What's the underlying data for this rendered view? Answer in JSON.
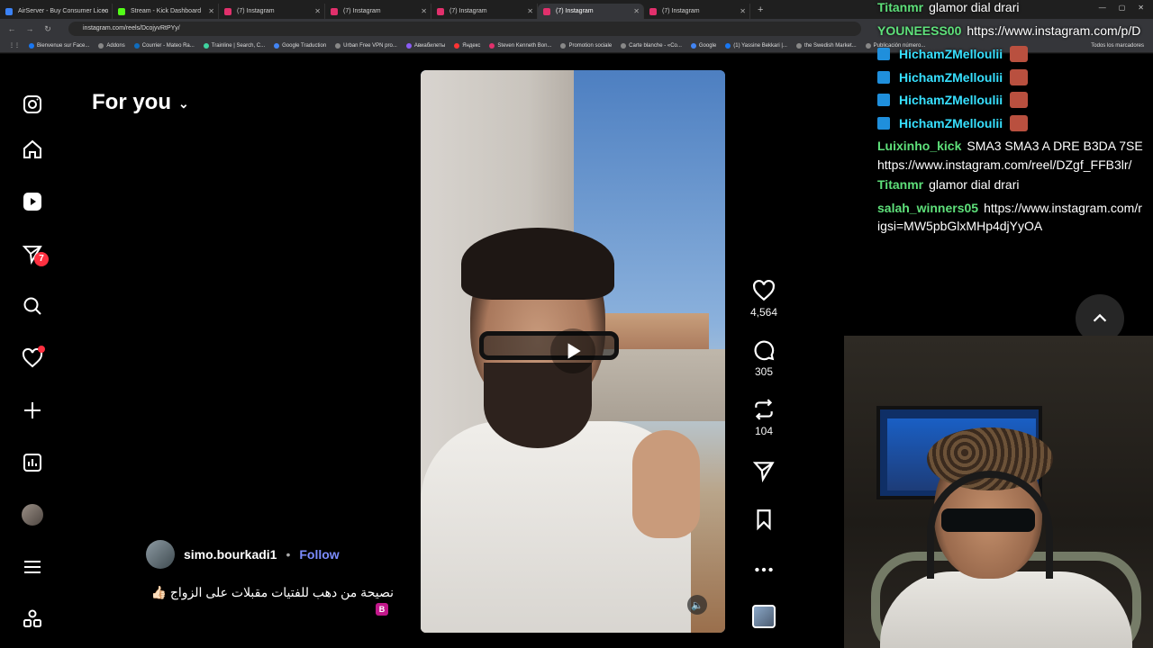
{
  "browser": {
    "tabs": [
      {
        "label": "AirServer - Buy Consumer Licen",
        "color": "#3b82f6"
      },
      {
        "label": "Stream - Kick Dashboard",
        "color": "#53fc18"
      },
      {
        "label": "(7) Instagram",
        "color": "#e1306c"
      },
      {
        "label": "(7) Instagram",
        "color": "#e1306c"
      },
      {
        "label": "(7) Instagram",
        "color": "#e1306c"
      },
      {
        "label": "(7) Instagram",
        "color": "#e1306c"
      },
      {
        "label": "(7) Instagram",
        "color": "#e1306c"
      }
    ],
    "url": "instagram.com/reels/DcojyvRtPYy/",
    "bookmarks": [
      "Bienvenue sur Face...",
      "Addons",
      "Courrier - Mateo Ra...",
      "Trainline | Search, C...",
      "Google Traduction",
      "Urban Free VPN pro...",
      "Авиабилеты",
      "Яндекс",
      "Steven Kenneth Bon...",
      "Promotion sociale",
      "Carte blanche - «Co...",
      "Google",
      "(1) Yassine Bekkari |...",
      "the Swedish Market...",
      "Publicación número..."
    ],
    "bookmarks_folder": "Todos los marcadores"
  },
  "sidebar": {
    "notifications_badge": "7"
  },
  "feed": {
    "title": "For you",
    "likes": "4,564",
    "comments": "305",
    "reposts": "104",
    "author": "simo.bourkadi1",
    "separator": "•",
    "follow_label": "Follow",
    "caption": "نصيحة من دهب للفتيات مقبلات على الزواج 👍🏻",
    "caption_badge": "B"
  },
  "chat": {
    "messages": [
      {
        "user": "Titanmr",
        "msg": "glamor dial drari"
      },
      {
        "user": "YOUNEESS00",
        "msg": "https://www.instagram.com/p/D"
      },
      {
        "user": "HichamZMelloulii",
        "msg": ""
      },
      {
        "user": "HichamZMelloulii",
        "msg": ""
      },
      {
        "user": "HichamZMelloulii",
        "msg": ""
      },
      {
        "user": "HichamZMelloulii",
        "msg": ""
      },
      {
        "user": "Luixinho_kick",
        "msg": "SMA3 SMA3 A DRE B3DA 7SE"
      },
      {
        "user": "",
        "msg": "https://www.instagram.com/reel/DZgf_FFB3lr/"
      },
      {
        "user": "Titanmr",
        "msg": "glamor dial drari"
      },
      {
        "user": "salah_winners05",
        "msg": "https://www.instagram.com/r"
      },
      {
        "user": "",
        "msg": "igsi=MW5pbGlxMHp4djYyOA"
      }
    ]
  }
}
